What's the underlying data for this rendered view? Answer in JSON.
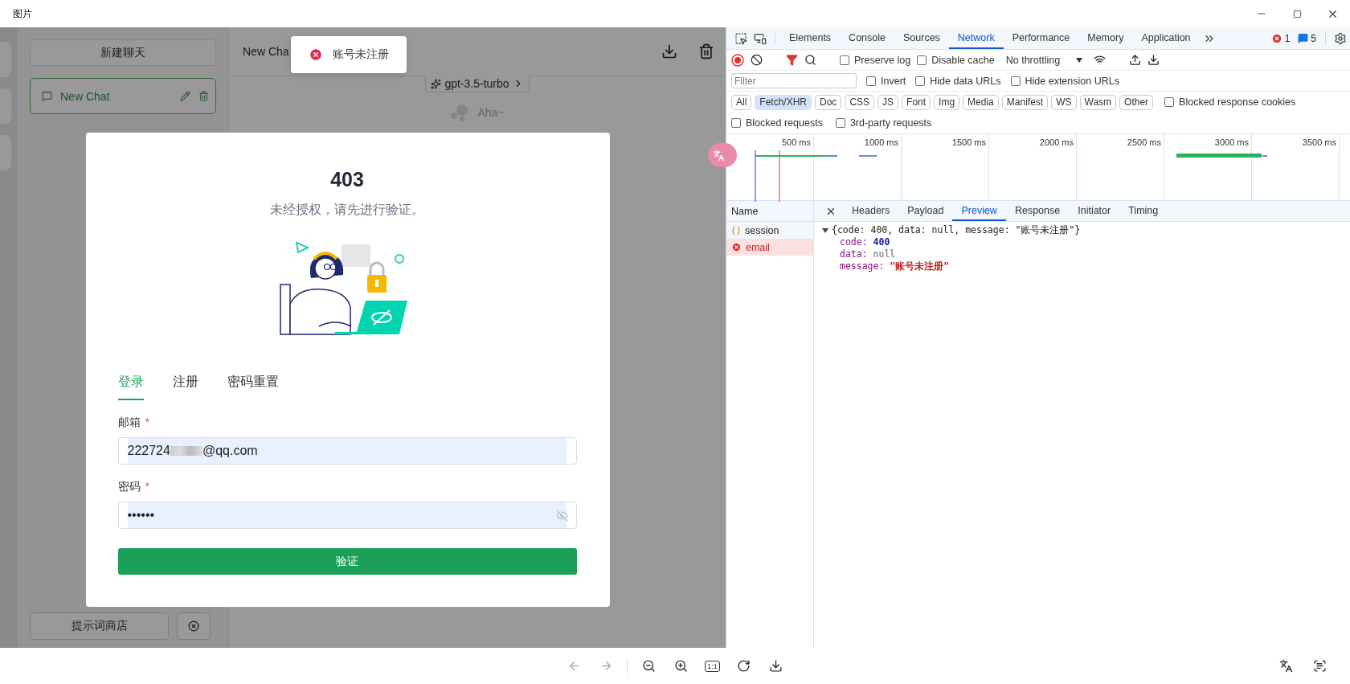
{
  "window": {
    "title": "图片"
  },
  "sidebar": {
    "new_chat_button": "新建聊天",
    "chats": [
      {
        "title": "New Chat",
        "selected": true
      }
    ],
    "prompt_store_button": "提示词商店"
  },
  "chat": {
    "title": "New Cha",
    "model": "gpt-3.5-turbo",
    "greeting": "Aha~"
  },
  "toast": {
    "message": "账号未注册"
  },
  "dialog": {
    "code": "403",
    "subtitle": "未经授权，请先进行验证。",
    "tabs": [
      {
        "label": "登录",
        "selected": true
      },
      {
        "label": "注册",
        "selected": false
      },
      {
        "label": "密码重置",
        "selected": false
      }
    ],
    "fields": [
      {
        "label": "邮箱",
        "required_mark": "*",
        "kind": "text",
        "value_start": "222724",
        "value_end": "@qq.com"
      },
      {
        "label": "密码",
        "required_mark": "*",
        "kind": "password",
        "value": "••••••"
      }
    ],
    "submit": "验证"
  },
  "devtools": {
    "panel_tabs": [
      {
        "label": "Elements",
        "selected": false
      },
      {
        "label": "Console",
        "selected": false
      },
      {
        "label": "Sources",
        "selected": false
      },
      {
        "label": "Network",
        "selected": true
      },
      {
        "label": "Performance",
        "selected": false
      },
      {
        "label": "Memory",
        "selected": false
      },
      {
        "label": "Application",
        "selected": false
      }
    ],
    "error_count": "1",
    "message_count": "5",
    "toolbar_checkboxes": [
      {
        "label": "Preserve log",
        "checked": false
      },
      {
        "label": "Disable cache",
        "checked": false
      }
    ],
    "throttling": "No throttling",
    "filter": {
      "placeholder": "Filter"
    },
    "filter_checkboxes": [
      {
        "label": "Invert",
        "checked": false
      },
      {
        "label": "Hide data URLs",
        "checked": false
      },
      {
        "label": "Hide extension URLs",
        "checked": false
      }
    ],
    "type_filters": [
      {
        "label": "All",
        "selected": false
      },
      {
        "label": "Fetch/XHR",
        "selected": true
      },
      {
        "label": "Doc",
        "selected": false
      },
      {
        "label": "CSS",
        "selected": false
      },
      {
        "label": "JS",
        "selected": false
      },
      {
        "label": "Font",
        "selected": false
      },
      {
        "label": "Img",
        "selected": false
      },
      {
        "label": "Media",
        "selected": false
      },
      {
        "label": "Manifest",
        "selected": false
      },
      {
        "label": "WS",
        "selected": false
      },
      {
        "label": "Wasm",
        "selected": false
      },
      {
        "label": "Other",
        "selected": false
      }
    ],
    "cookie_checkbox": {
      "label": "Blocked response cookies",
      "checked": false
    },
    "request_checkboxes": [
      {
        "label": "Blocked requests",
        "checked": false
      },
      {
        "label": "3rd-party requests",
        "checked": false
      }
    ],
    "timeline_ticks": [
      "500 ms",
      "1000 ms",
      "1500 ms",
      "2000 ms",
      "2500 ms",
      "3000 ms",
      "3500 ms"
    ],
    "name_header": "Name",
    "requests": [
      {
        "name": "session",
        "failed": false,
        "selected": false
      },
      {
        "name": "email",
        "failed": true,
        "selected": true
      }
    ],
    "detail_tabs": [
      {
        "label": "Headers",
        "selected": false
      },
      {
        "label": "Payload",
        "selected": false
      },
      {
        "label": "Preview",
        "selected": true
      },
      {
        "label": "Response",
        "selected": false
      },
      {
        "label": "Initiator",
        "selected": false
      },
      {
        "label": "Timing",
        "selected": false
      }
    ],
    "preview": {
      "summary": "{code: 400, data: null, message: \"账号未注册\"}",
      "expanded": true,
      "fields": [
        {
          "key": "code:",
          "value": "400",
          "color": "#1a1aa6"
        },
        {
          "key": "data:",
          "value": "null",
          "color": "#999999"
        },
        {
          "key": "message:",
          "value": "\"账号未注册\"",
          "color": "#c41a16"
        }
      ]
    }
  },
  "viewer": {
    "actual_size_label": "1:1"
  }
}
